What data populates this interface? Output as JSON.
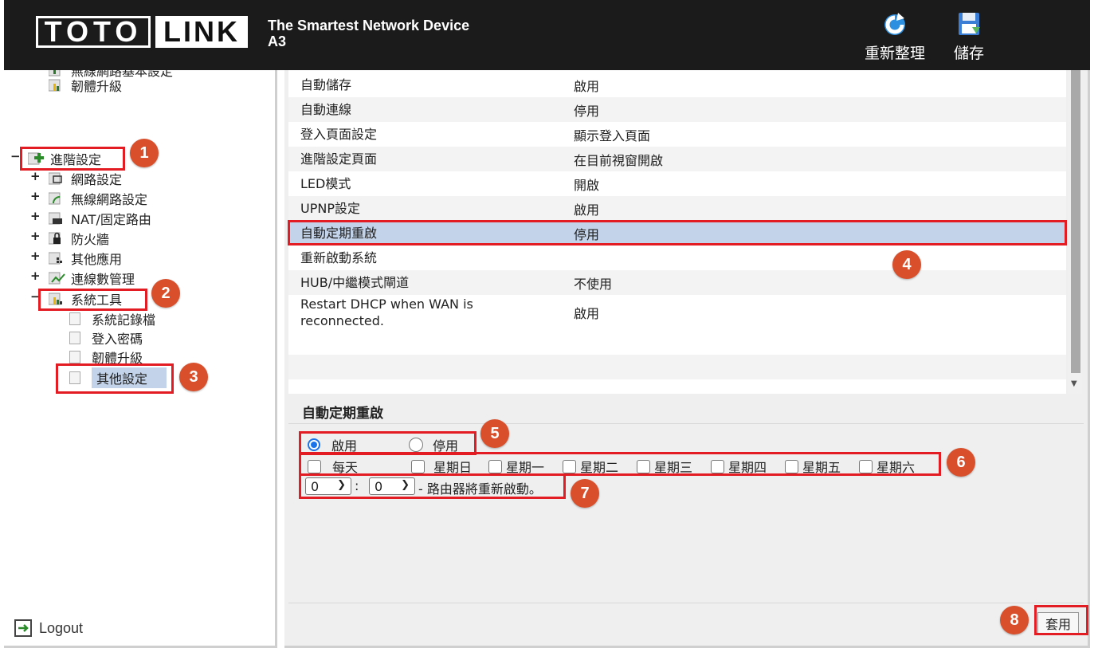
{
  "header": {
    "logo_left": "TOTO",
    "logo_right": "LINK",
    "tagline_line1": "The Smartest Network Device",
    "tagline_line2": "A3",
    "refresh_label": "重新整理",
    "save_label": "儲存"
  },
  "tree": {
    "partial_item": "無線網路基本設定",
    "top_item": "韌體升級",
    "advanced": "進階設定",
    "children": [
      "網路設定",
      "無線網路設定",
      "NAT/固定路由",
      "防火牆",
      "其他應用",
      "連線數管理"
    ],
    "system_tools": "系統工具",
    "system_children": [
      "系統記錄檔",
      "登入密碼",
      "韌體升級",
      "其他設定"
    ],
    "logout": "Logout"
  },
  "settings": [
    {
      "key": "自動儲存",
      "value": "啟用"
    },
    {
      "key": "自動連線",
      "value": "停用"
    },
    {
      "key": "登入頁面設定",
      "value": "顯示登入頁面"
    },
    {
      "key": "進階設定頁面",
      "value": "在目前視窗開啟"
    },
    {
      "key": "LED模式",
      "value": "開啟"
    },
    {
      "key": "UPNP設定",
      "value": "啟用"
    },
    {
      "key": "自動定期重啟",
      "value": "停用"
    },
    {
      "key": "重新啟動系統",
      "value": ""
    },
    {
      "key": "HUB/中繼模式閘道",
      "value": "不使用"
    },
    {
      "key": "Restart DHCP when WAN is reconnected.",
      "value": "啟用"
    }
  ],
  "detail": {
    "title": "自動定期重啟",
    "radio_enable": "啟用",
    "radio_disable": "停用",
    "everyday": "每天",
    "days": [
      "星期日",
      "星期一",
      "星期二",
      "星期三",
      "星期四",
      "星期五",
      "星期六"
    ],
    "hour_value": "0",
    "minute_value": "0",
    "colon": ":",
    "suffix": "- 路由器將重新啟動。",
    "apply": "套用"
  },
  "badges": [
    "1",
    "2",
    "3",
    "4",
    "5",
    "6",
    "7",
    "8"
  ],
  "colors": {
    "header_bg": "#1b1b1b",
    "annotation_red": "#e31b23",
    "badge_orange": "#d94f2b",
    "selected_row": "#c3d3ea"
  }
}
